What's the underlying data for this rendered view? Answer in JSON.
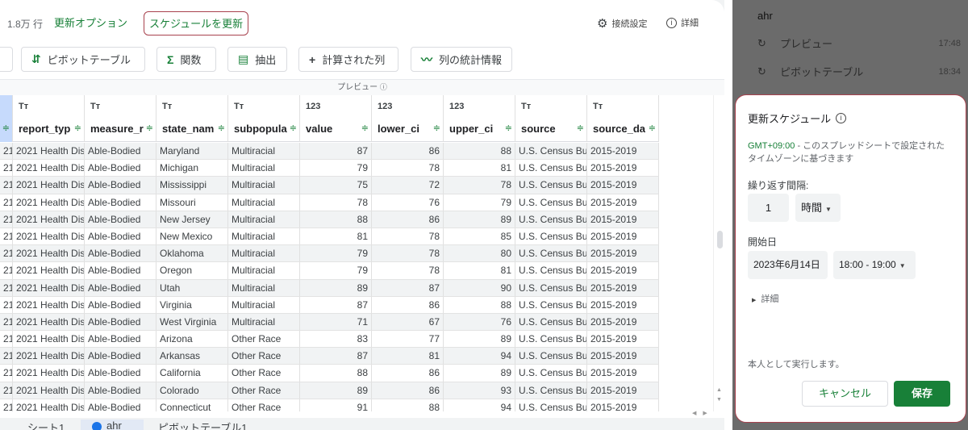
{
  "topbar": {
    "rows_count": "1.8万 行",
    "update_options": "更新オプション",
    "update_schedule": "スケジュールを更新",
    "connection_settings": "接続設定",
    "details": "詳細"
  },
  "toolbar": {
    "pivot_table": "ピボットテーブル",
    "functions": "関数",
    "extract": "抽出",
    "calculated_column": "計算された列",
    "column_stats": "列の統計情報"
  },
  "preview_label": "プレビュー",
  "grid": {
    "columns": [
      {
        "type": "Tт",
        "name": "report_typ"
      },
      {
        "type": "Tт",
        "name": "measure_r"
      },
      {
        "type": "Tт",
        "name": "state_nam"
      },
      {
        "type": "Tт",
        "name": "subpopula"
      },
      {
        "type": "123",
        "name": "value"
      },
      {
        "type": "123",
        "name": "lower_ci"
      },
      {
        "type": "123",
        "name": "upper_ci"
      },
      {
        "type": "Tт",
        "name": "source"
      },
      {
        "type": "Tт",
        "name": "source_da"
      }
    ],
    "rows": [
      [
        "21",
        "2021 Health Dis",
        "Able-Bodied",
        "Maryland",
        "Multiracial",
        "87",
        "86",
        "88",
        "U.S. Census Bu",
        "2015-2019"
      ],
      [
        "21",
        "2021 Health Dis",
        "Able-Bodied",
        "Michigan",
        "Multiracial",
        "79",
        "78",
        "81",
        "U.S. Census Bu",
        "2015-2019"
      ],
      [
        "21",
        "2021 Health Dis",
        "Able-Bodied",
        "Mississippi",
        "Multiracial",
        "75",
        "72",
        "78",
        "U.S. Census Bu",
        "2015-2019"
      ],
      [
        "21",
        "2021 Health Dis",
        "Able-Bodied",
        "Missouri",
        "Multiracial",
        "78",
        "76",
        "79",
        "U.S. Census Bu",
        "2015-2019"
      ],
      [
        "21",
        "2021 Health Dis",
        "Able-Bodied",
        "New Jersey",
        "Multiracial",
        "88",
        "86",
        "89",
        "U.S. Census Bu",
        "2015-2019"
      ],
      [
        "21",
        "2021 Health Dis",
        "Able-Bodied",
        "New Mexico",
        "Multiracial",
        "81",
        "78",
        "85",
        "U.S. Census Bu",
        "2015-2019"
      ],
      [
        "21",
        "2021 Health Dis",
        "Able-Bodied",
        "Oklahoma",
        "Multiracial",
        "79",
        "78",
        "80",
        "U.S. Census Bu",
        "2015-2019"
      ],
      [
        "21",
        "2021 Health Dis",
        "Able-Bodied",
        "Oregon",
        "Multiracial",
        "79",
        "78",
        "81",
        "U.S. Census Bu",
        "2015-2019"
      ],
      [
        "21",
        "2021 Health Dis",
        "Able-Bodied",
        "Utah",
        "Multiracial",
        "89",
        "87",
        "90",
        "U.S. Census Bu",
        "2015-2019"
      ],
      [
        "21",
        "2021 Health Dis",
        "Able-Bodied",
        "Virginia",
        "Multiracial",
        "87",
        "86",
        "88",
        "U.S. Census Bu",
        "2015-2019"
      ],
      [
        "21",
        "2021 Health Dis",
        "Able-Bodied",
        "West Virginia",
        "Multiracial",
        "71",
        "67",
        "76",
        "U.S. Census Bu",
        "2015-2019"
      ],
      [
        "21",
        "2021 Health Dis",
        "Able-Bodied",
        "Arizona",
        "Other Race",
        "83",
        "77",
        "89",
        "U.S. Census Bu",
        "2015-2019"
      ],
      [
        "21",
        "2021 Health Dis",
        "Able-Bodied",
        "Arkansas",
        "Other Race",
        "87",
        "81",
        "94",
        "U.S. Census Bu",
        "2015-2019"
      ],
      [
        "21",
        "2021 Health Dis",
        "Able-Bodied",
        "California",
        "Other Race",
        "88",
        "86",
        "89",
        "U.S. Census Bu",
        "2015-2019"
      ],
      [
        "21",
        "2021 Health Dis",
        "Able-Bodied",
        "Colorado",
        "Other Race",
        "89",
        "86",
        "93",
        "U.S. Census Bu",
        "2015-2019"
      ],
      [
        "21",
        "2021 Health Dis",
        "Able-Bodied",
        "Connecticut",
        "Other Race",
        "91",
        "88",
        "94",
        "U.S. Census Bu",
        "2015-2019"
      ]
    ]
  },
  "sheet_tabs": [
    "シート1",
    "ahr",
    "ピボットテーブル1"
  ],
  "side": {
    "title": "ahr",
    "items": [
      {
        "label": "プレビュー",
        "time": "17:48"
      },
      {
        "label": "ピボットテーブル",
        "time": "18:34"
      }
    ]
  },
  "dialog": {
    "title": "更新スケジュール",
    "timezone": "GMT+09:00",
    "timezone_desc": " - このスプレッドシートで設定されたタイムゾーンに基づきます",
    "interval_label": "繰り返す間隔:",
    "interval_value": "1",
    "interval_unit": "時間",
    "start_label": "開始日",
    "start_date": "2023年6月14日",
    "start_time": "18:00 - 19:00",
    "details": "詳細",
    "run_as": "本人として実行します。",
    "cancel": "キャンセル",
    "save": "保存"
  },
  "colors": {
    "accent_green": "#188038",
    "highlight_border": "#a8424e"
  }
}
